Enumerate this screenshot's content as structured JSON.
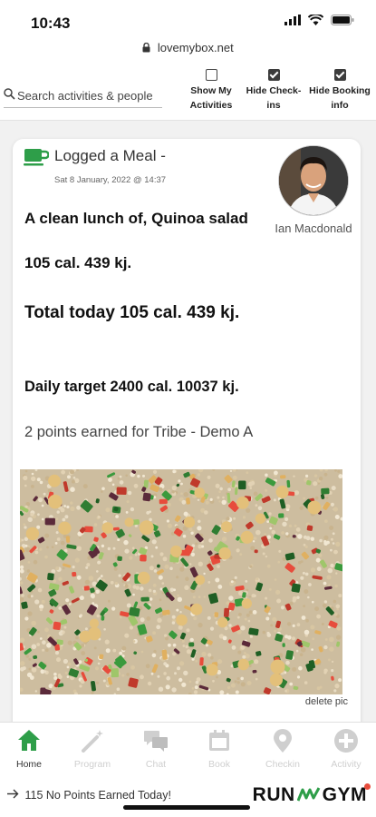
{
  "status": {
    "time": "10:43"
  },
  "browser": {
    "url": "lovemybox.net"
  },
  "filters": {
    "search_placeholder": "Search activities & people",
    "toggles": [
      {
        "label": "Show My Activities",
        "checked": false
      },
      {
        "label": "Hide Check-ins",
        "checked": true
      },
      {
        "label": "Hide Booking info",
        "checked": true
      }
    ]
  },
  "post": {
    "activity_title": "Logged a Meal -",
    "timestamp": "Sat 8 January, 2022 @ 14:37",
    "member_name": "Ian Macdonald",
    "meal_description": "A clean lunch of, Quinoa salad",
    "meal_calories": "105 cal. 439 kj.",
    "total_today": "Total today 105 cal. 439 kj.",
    "daily_target": "Daily target 2400 cal. 10037 kj.",
    "points_earned": "2 points earned for Tribe - Demo A",
    "delete_pic_label": "delete pic"
  },
  "tabs": [
    {
      "label": "Home",
      "icon": "home-icon",
      "active": true
    },
    {
      "label": "Program",
      "icon": "magic-wand-icon",
      "active": false
    },
    {
      "label": "Chat",
      "icon": "chat-icon",
      "active": false
    },
    {
      "label": "Book",
      "icon": "calendar-icon",
      "active": false
    },
    {
      "label": "Checkin",
      "icon": "location-pin-icon",
      "active": false
    },
    {
      "label": "Activity",
      "icon": "plus-circle-icon",
      "active": false
    }
  ],
  "footer": {
    "points_banner": "115 No Points Earned Today!",
    "brand_left": "RUN",
    "brand_right": "GYM"
  },
  "colors": {
    "accent_green": "#2e9e49",
    "inactive_gray": "#cfcfcf",
    "brand_dot": "#e74c3c"
  }
}
